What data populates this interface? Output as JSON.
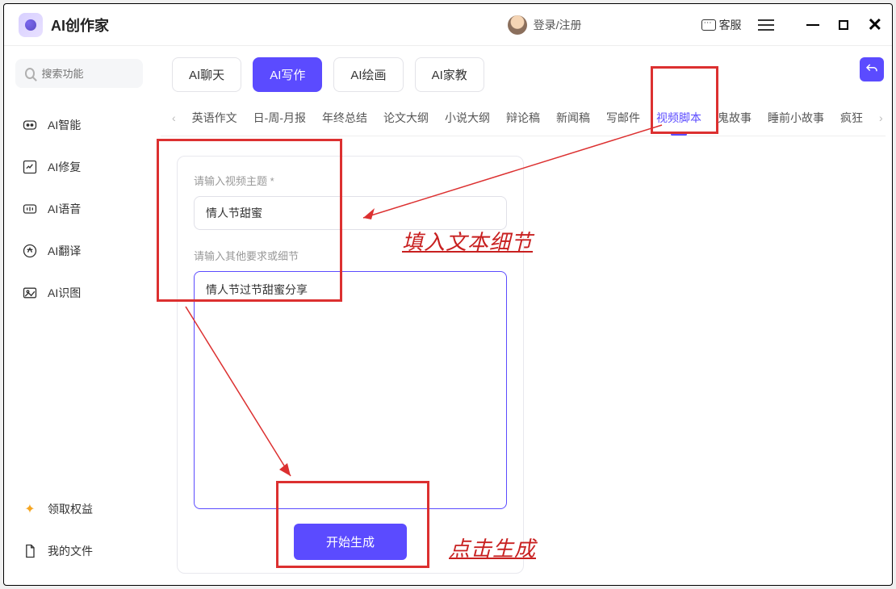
{
  "app": {
    "title": "AI创作家"
  },
  "header": {
    "login": "登录/注册",
    "customer_service": "客服"
  },
  "search": {
    "placeholder": "搜索功能"
  },
  "sidebar": {
    "items": [
      {
        "label": "AI智能"
      },
      {
        "label": "AI修复"
      },
      {
        "label": "AI语音"
      },
      {
        "label": "AI翻译"
      },
      {
        "label": "AI识图"
      }
    ],
    "reward": "领取权益",
    "files": "我的文件"
  },
  "modes": {
    "chat": "AI聊天",
    "write": "AI写作",
    "paint": "AI绘画",
    "tutor": "AI家教"
  },
  "categories": [
    "英语作文",
    "日-周-月报",
    "年终总结",
    "论文大纲",
    "小说大纲",
    "辩论稿",
    "新闻稿",
    "写邮件",
    "视频脚本",
    "鬼故事",
    "睡前小故事",
    "疯狂"
  ],
  "form": {
    "topic_label": "请输入视频主题 *",
    "topic_value": "情人节甜蜜",
    "detail_label": "请输入其他要求或细节",
    "detail_value": "情人节过节甜蜜分享",
    "submit": "开始生成"
  },
  "annotations": {
    "fill_text": "填入文本细节",
    "click_generate": "点击生成"
  }
}
